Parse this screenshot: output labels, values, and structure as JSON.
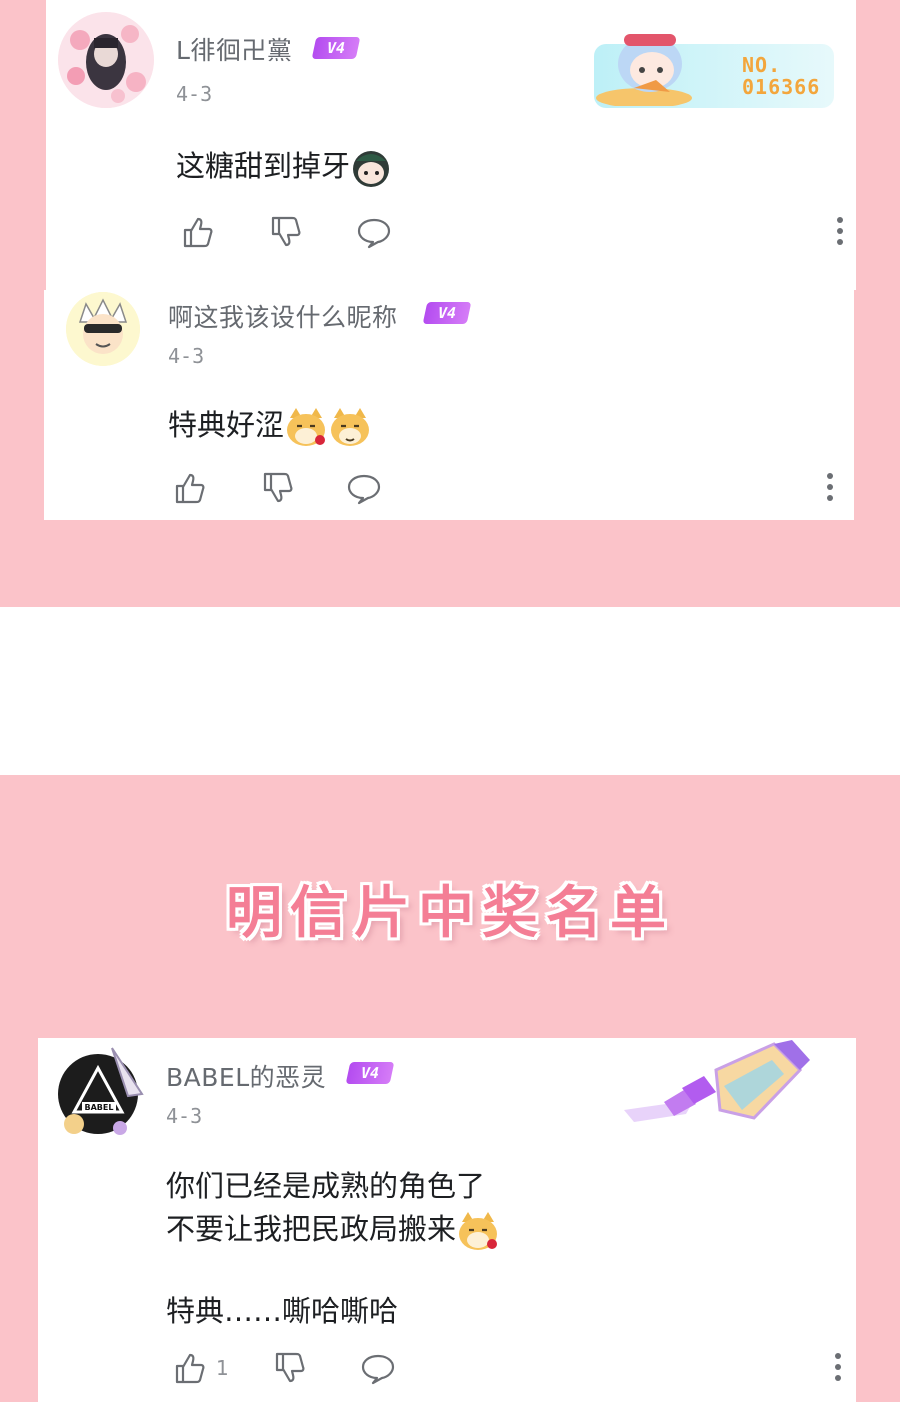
{
  "colors": {
    "background_pink": "#fbc3c9",
    "card": "#ffffff",
    "badge": "#b44cf0",
    "title": "#f47e95",
    "username": "#666a70",
    "date": "#8e9196",
    "text": "#1d1f22"
  },
  "section_title": "明信片中奖名单",
  "comments": [
    {
      "username": "L徘徊卍黨",
      "level": "V4",
      "date": "4-3",
      "text": "这糖甜到掉牙",
      "decoration": {
        "label": "NO.",
        "number": "016366"
      },
      "actions": {
        "like": "like-icon",
        "dislike": "dislike-icon",
        "reply": "reply-icon",
        "more": "more-icon"
      }
    },
    {
      "username": "啊这我该设什么昵称",
      "level": "V4",
      "date": "4-3",
      "text": "特典好涩",
      "actions": {
        "like": "like-icon",
        "dislike": "dislike-icon",
        "reply": "reply-icon",
        "more": "more-icon"
      }
    },
    {
      "username": "BABEL的恶灵",
      "level": "V4",
      "date": "4-3",
      "lines": [
        "你们已经是成熟的角色了",
        "不要让我把民政局搬来",
        "特典……嘶哈嘶哈"
      ],
      "avatar_text": "BABEL",
      "like_count": "1",
      "actions": {
        "like": "like-icon",
        "dislike": "dislike-icon",
        "reply": "reply-icon",
        "more": "more-icon"
      }
    }
  ]
}
